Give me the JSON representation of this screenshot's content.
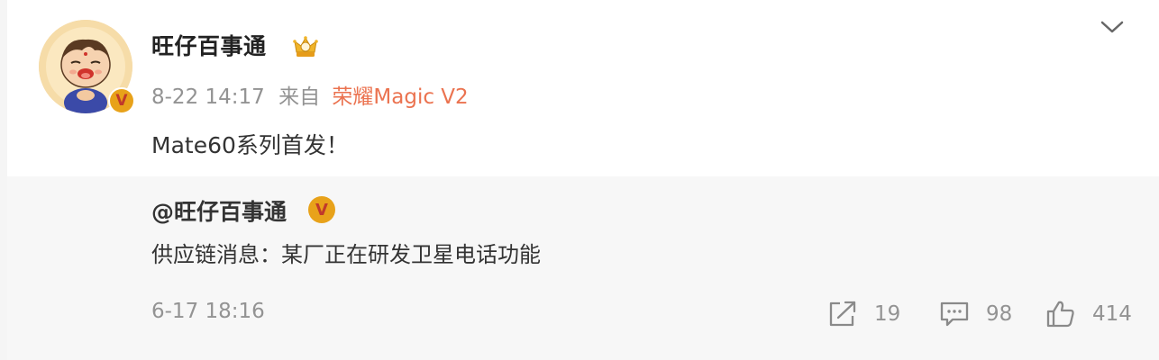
{
  "post": {
    "author": "旺仔百事通",
    "time": "8-22 14:17",
    "source_prefix": "来自",
    "source": "荣耀Magic V2",
    "text": "Mate60系列首发！"
  },
  "repost": {
    "author": "@旺仔百事通",
    "text": "供应链消息：某厂正在研发卫星电话功能",
    "time": "6-17 18:16",
    "actions": {
      "share_count": "19",
      "comment_count": "98",
      "like_count": "414"
    }
  },
  "icons": {
    "crown": "crown-badge-icon",
    "verified": "verified-v-icon",
    "chevron": "chevron-down-icon",
    "share": "share-icon",
    "comment": "comment-icon",
    "like": "thumbs-up-icon"
  },
  "colors": {
    "source_link": "#eb7350",
    "meta_gray": "#939393",
    "repost_background": "#f7f7f7",
    "verified_badge": "#e8a21a"
  }
}
